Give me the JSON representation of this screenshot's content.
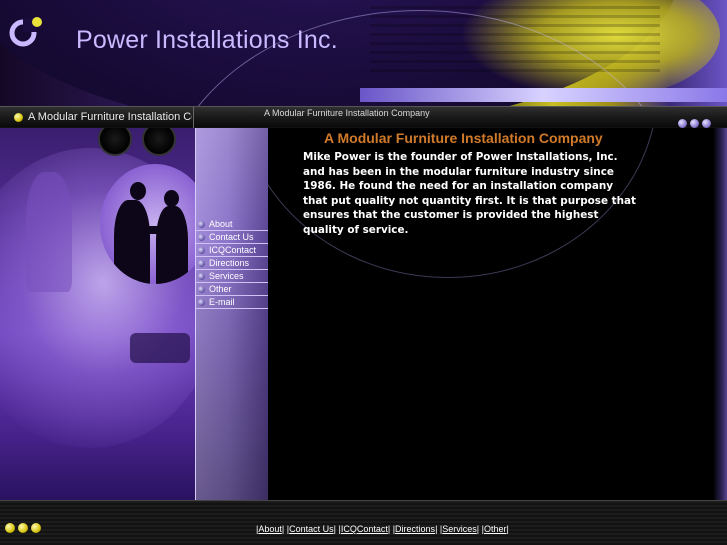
{
  "header": {
    "title": "Power Installations Inc."
  },
  "tagbar": {
    "left_text": "A Modular Furniture Installation Co",
    "right_text": "A Modular Furniture Installation Company"
  },
  "nav": {
    "items": [
      {
        "label": "About"
      },
      {
        "label": "Contact Us"
      },
      {
        "label": "ICQContact"
      },
      {
        "label": "Directions"
      },
      {
        "label": "Services"
      },
      {
        "label": "Other"
      },
      {
        "label": "E-mail"
      }
    ]
  },
  "content": {
    "heading": "A Modular Furniture Installation Company",
    "body": "Mike Power is the founder of Power Installations, Inc. and has been in the modular furniture industry since 1986. He found the need for an installation company that put quality not quantity first. It is that purpose that ensures that the customer is provided the highest quality of service."
  },
  "footer": {
    "links": [
      {
        "label": "About"
      },
      {
        "label": "Contact Us"
      },
      {
        "label": "ICQContact"
      },
      {
        "label": "Directions"
      },
      {
        "label": "Services"
      },
      {
        "label": "Other"
      }
    ],
    "separator": "|"
  },
  "colors": {
    "heading": "#d07a2a",
    "accent_purple": "#6a4fb5",
    "accent_yellow": "#d8c610"
  },
  "icons": [
    "logo-icon",
    "yellow-bullet-icon",
    "purple-dot-icon",
    "nav-dot-icon"
  ]
}
